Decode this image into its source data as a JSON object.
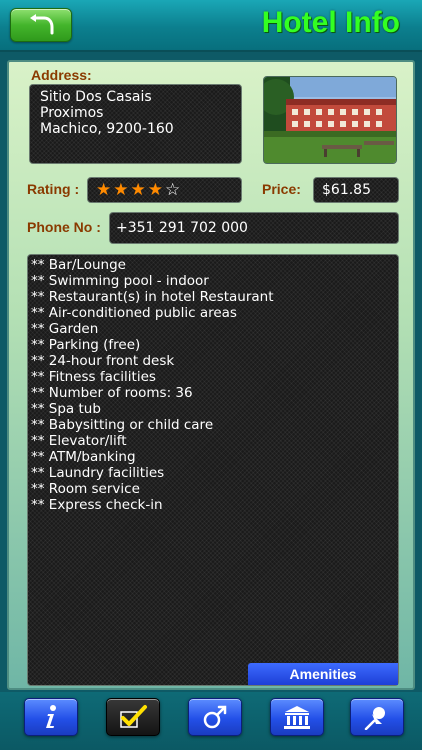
{
  "header": {
    "title": "Hotel Info",
    "back_icon": "back-arrow-icon"
  },
  "address": {
    "label": "Address:",
    "lines": [
      "Sitio Dos Casais",
      "Proximos",
      "Machico, 9200-160"
    ]
  },
  "rating": {
    "label": "Rating :",
    "value": 4,
    "max": 5
  },
  "price": {
    "label": "Price:",
    "value": "$61.85"
  },
  "phone": {
    "label": "Phone No :",
    "value": "+351 291 702 000"
  },
  "amenities": {
    "tab_label": "Amenities",
    "items": [
      "** Bar/Lounge",
      "** Swimming pool - indoor",
      "** Restaurant(s) in hotel Restaurant",
      "** Air-conditioned public areas",
      "** Garden",
      "** Parking (free)",
      "** 24-hour front desk",
      "** Fitness facilities",
      "** Number of rooms: 36",
      "** Spa tub",
      "** Babysitting or child care",
      "** Elevator/lift",
      "** ATM/banking",
      "** Laundry facilities",
      "** Room service",
      "** Express check-in"
    ]
  },
  "toolbar": {
    "buttons": [
      {
        "icon": "info-icon",
        "active": false
      },
      {
        "icon": "checkmark-icon",
        "active": true
      },
      {
        "icon": "male-symbol-icon",
        "active": false
      },
      {
        "icon": "bank-icon",
        "active": false
      },
      {
        "icon": "pushpin-icon",
        "active": false
      }
    ]
  },
  "colors": {
    "title": "#33ff22",
    "label": "#8a3a00",
    "star": "#ff8a00",
    "toolbar_button": "#2350e8",
    "back_button": "#44b52c"
  }
}
